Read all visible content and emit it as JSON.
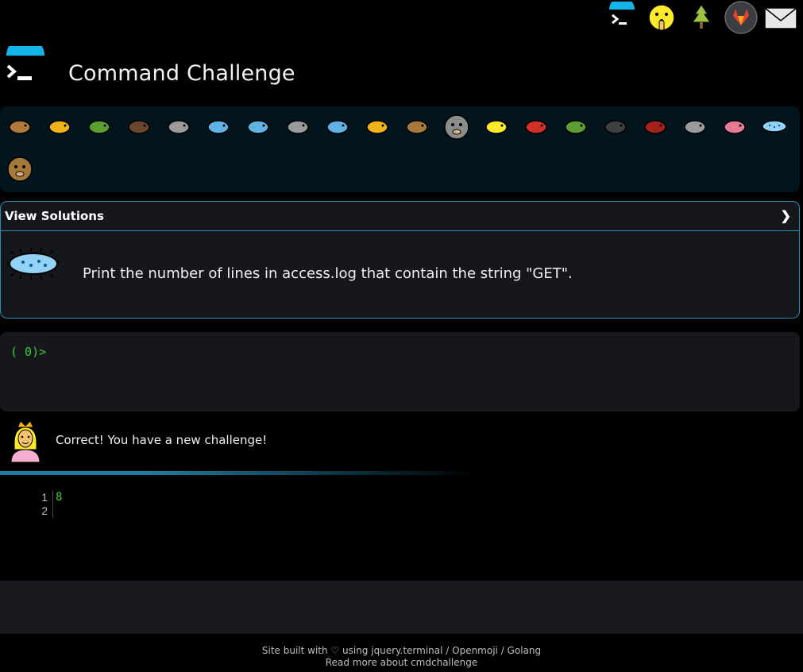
{
  "app": {
    "title": "Command Challenge"
  },
  "top_icons": [
    {
      "name": "cmdchallenge-logo-icon"
    },
    {
      "name": "shushing-face-icon"
    },
    {
      "name": "tree-icon"
    },
    {
      "name": "gitlab-icon"
    },
    {
      "name": "mail-icon"
    }
  ],
  "creatures_row1": [
    "snail-icon",
    "butterfly-icon",
    "caterpillar-icon",
    "ant-icon",
    "spider-web-icon",
    "whale-icon",
    "dolphin-icon",
    "shark-icon",
    "fish-icon",
    "tropical-fish-icon",
    "blowfish-icon",
    "wolf-icon",
    "bee-icon",
    "ladybug-icon",
    "cricket-icon",
    "spider-icon",
    "scorpion-icon",
    "fly-icon",
    "worm-icon",
    "microbe-icon"
  ],
  "creatures_row2": [
    "monkey-icon"
  ],
  "solutions": {
    "label": "View Solutions",
    "chevron": "❯"
  },
  "challenge": {
    "icon": "microbe-icon",
    "text": "Print the number of lines in access.log that contain the string \"GET\"."
  },
  "terminal": {
    "prompt": "( 0)>"
  },
  "feedback": {
    "avatar": "princess-icon",
    "message": "Correct! You have a new challenge!"
  },
  "output": {
    "line_numbers": [
      "1",
      "2"
    ],
    "lines": [
      "8",
      ""
    ]
  },
  "footer": {
    "line1_prefix": "Site built with ♡ using ",
    "link1": "jquery.terminal",
    "sep1": " / ",
    "link2": "Openmoji",
    "sep2": " / ",
    "link3": "Golang",
    "line2": "Read more about cmdchallenge"
  },
  "colors": {
    "accent": "#2b8fb5",
    "prompt_green": "#3ec93e",
    "panel_bg": "#15171a",
    "emoji_bar_bg": "#02141c"
  }
}
